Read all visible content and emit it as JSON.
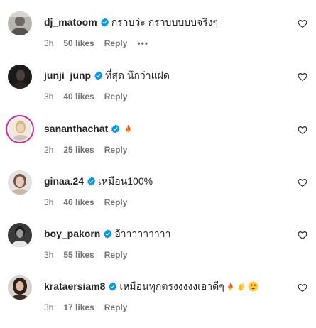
{
  "comments": [
    {
      "username": "dj_matoom",
      "text": "กราบว่ะ กราบบบบบจริงๆ",
      "time": "3h",
      "likes": "50 likes",
      "reply": "Reply",
      "more": "•••",
      "avatar": "avatar-photo-gray"
    },
    {
      "username": "junji_junp",
      "text": "ที่สุด นึกว่าแฝด",
      "time": "3h",
      "likes": "40 likes",
      "reply": "Reply",
      "avatar": "avatar-photo-dark"
    },
    {
      "username": "sananthachat",
      "text": "",
      "time": "2h",
      "likes": "25 likes",
      "reply": "Reply",
      "avatar": "avatar-photo-story-ring",
      "emojis": [
        "fire-emoji"
      ]
    },
    {
      "username": "ginaa.24",
      "text": "เหมือน100%",
      "time": "3h",
      "likes": "46 likes",
      "reply": "Reply",
      "avatar": "avatar-photo-light"
    },
    {
      "username": "boy_pakorn",
      "text": "อ้าาาาาาาาา",
      "time": "3h",
      "likes": "55 likes",
      "reply": "Reply",
      "avatar": "avatar-photo-bw"
    },
    {
      "username": "krataersiam8",
      "text": "เหมือนทุกตรงงงงงเอาดีๆ",
      "time": "3h",
      "likes": "17 likes",
      "reply": "Reply",
      "avatar": "avatar-photo-dark-hair",
      "emojis": [
        "fire-emoji",
        "clapping-hands-emoji",
        "heart-eyes-emoji"
      ]
    }
  ],
  "colors": {
    "verified": "#0095f6",
    "meta": "#737373",
    "text": "#262626",
    "story_ring": "#d6249f"
  },
  "icons": {
    "verified": "verified-badge-icon",
    "like": "heart-outline-icon"
  }
}
